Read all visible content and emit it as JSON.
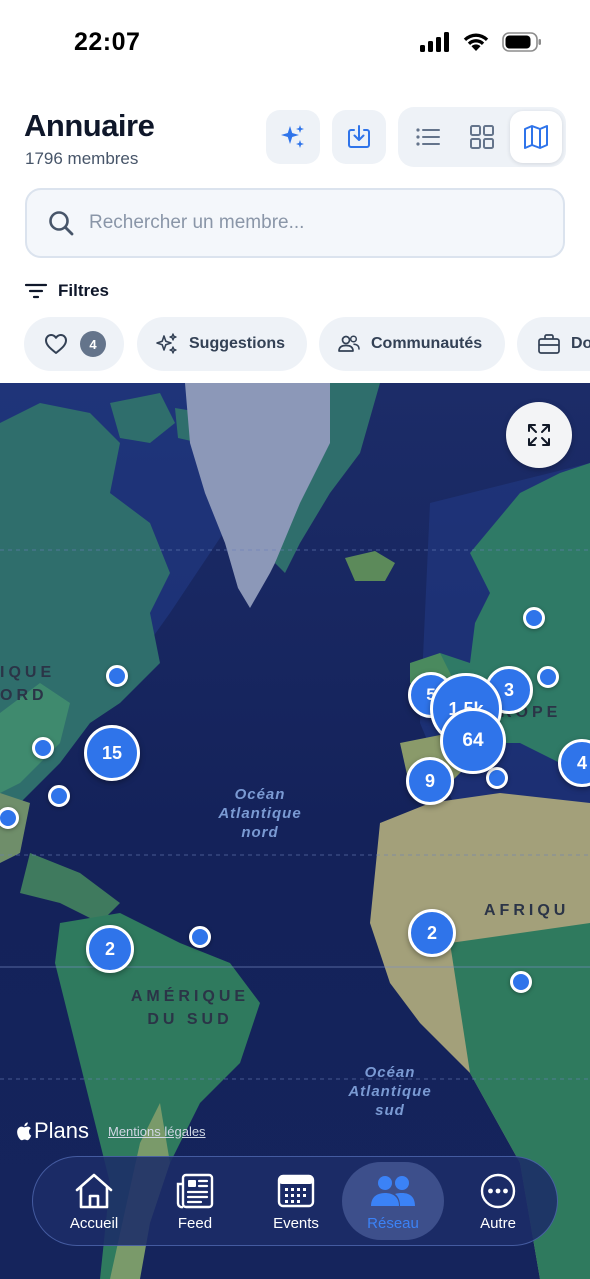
{
  "status_bar": {
    "time": "22:07"
  },
  "header": {
    "title": "Annuaire",
    "subtitle": "1796 membres"
  },
  "search": {
    "placeholder": "Rechercher un membre..."
  },
  "filters": {
    "label": "Filtres"
  },
  "chips": {
    "favorites_count": "4",
    "suggestions": "Suggestions",
    "communities": "Communautés",
    "domains_partial": "Do"
  },
  "map": {
    "ocean_north_atlantic": [
      "Océan",
      "Atlantique",
      "nord"
    ],
    "ocean_south_atlantic": [
      "Océan",
      "Atlantique",
      "sud"
    ],
    "region_north_america": [
      "IQUE",
      "ORD"
    ],
    "region_south_america": [
      "AMÉRIQUE",
      "DU SUD"
    ],
    "region_europe": "ROPE",
    "region_africa": "AFRIQU",
    "clusters": [
      {
        "label": "15"
      },
      {
        "label": "2"
      },
      {
        "label": "64"
      },
      {
        "label": "9"
      },
      {
        "label": "3"
      },
      {
        "label": "1,5k"
      },
      {
        "label": "5"
      },
      {
        "label": "2"
      },
      {
        "label": "4"
      }
    ],
    "attribution_brand": "Plans",
    "attribution_legal": "Mentions légales"
  },
  "tabbar": {
    "tabs": [
      {
        "label": "Accueil",
        "icon": "home-icon"
      },
      {
        "label": "Feed",
        "icon": "newspaper-icon"
      },
      {
        "label": "Events",
        "icon": "calendar-icon"
      },
      {
        "label": "Réseau",
        "icon": "people-icon",
        "active": true
      },
      {
        "label": "Autre",
        "icon": "more-icon"
      }
    ]
  },
  "colors": {
    "accent": "#2f74ea",
    "tab_active": "#3b82f6",
    "map_ocean": "#16245a"
  }
}
